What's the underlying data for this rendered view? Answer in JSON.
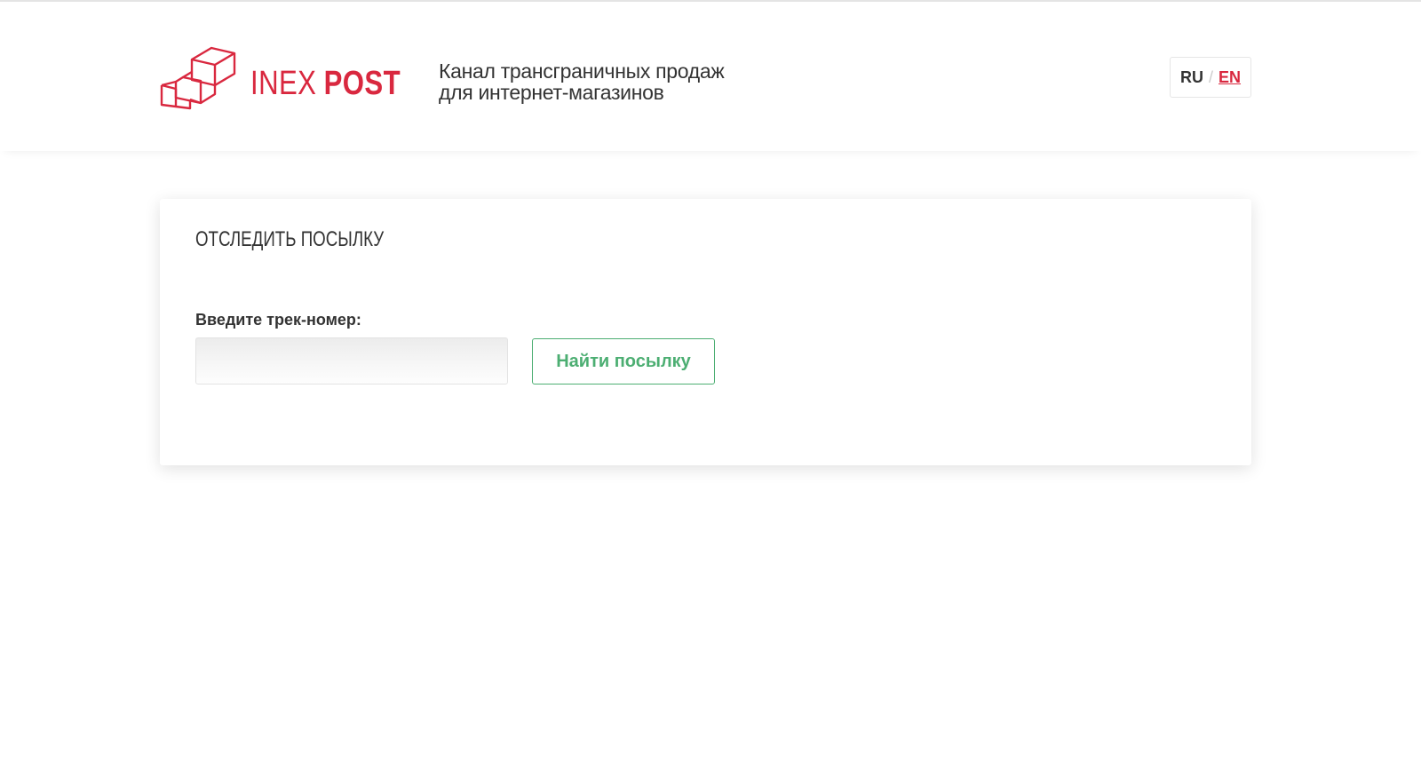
{
  "header": {
    "logo": {
      "brand_primary": "INEX",
      "brand_secondary": "POST",
      "icon": "stacked-boxes-logo-icon",
      "color": "#d9283f"
    },
    "tagline": {
      "line1": "Канал трансграничных продаж",
      "line2": "для интернет-магазинов"
    },
    "language_switch": {
      "ru": "RU",
      "separator": "/",
      "en": "EN",
      "active": "EN",
      "active_color": "#d9283f"
    }
  },
  "tracking": {
    "title": "Отследить посылку",
    "field_label": "Введите трек-номер:",
    "input_value": "",
    "button_label": "Найти посылку",
    "button_color": "#4cae72"
  }
}
